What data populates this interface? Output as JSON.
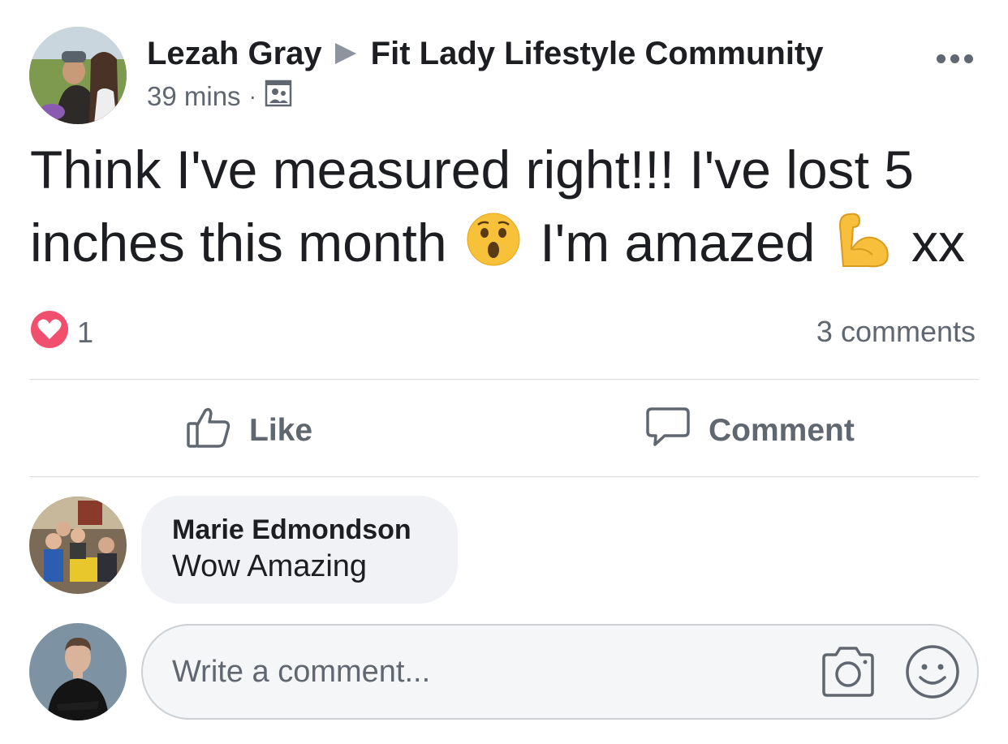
{
  "post": {
    "author": "Lezah Gray",
    "group": "Fit Lady Lifestyle Community",
    "time": "39 mins",
    "separator": "·",
    "privacy_icon": "group-members-icon",
    "text_before_emoji": "Think I've measured right!!! I've lost 5 inches this month",
    "text_middle": "I'm amazed",
    "text_end": "xx",
    "emoji_1": "astonished-face",
    "emoji_2": "flexed-biceps"
  },
  "reactions": {
    "count": "1",
    "icon": "love-reaction-icon",
    "color": "#f0506e"
  },
  "comments_count": "3 comments",
  "actions": {
    "like_label": "Like",
    "comment_label": "Comment"
  },
  "comment": {
    "author": "Marie Edmondson",
    "text": "Wow Amazing"
  },
  "composer": {
    "placeholder": "Write a comment...",
    "value": ""
  },
  "colors": {
    "text": "#1c1e21",
    "secondary": "#606770",
    "divider": "#dadde1",
    "bubble": "#f0f2f5"
  }
}
